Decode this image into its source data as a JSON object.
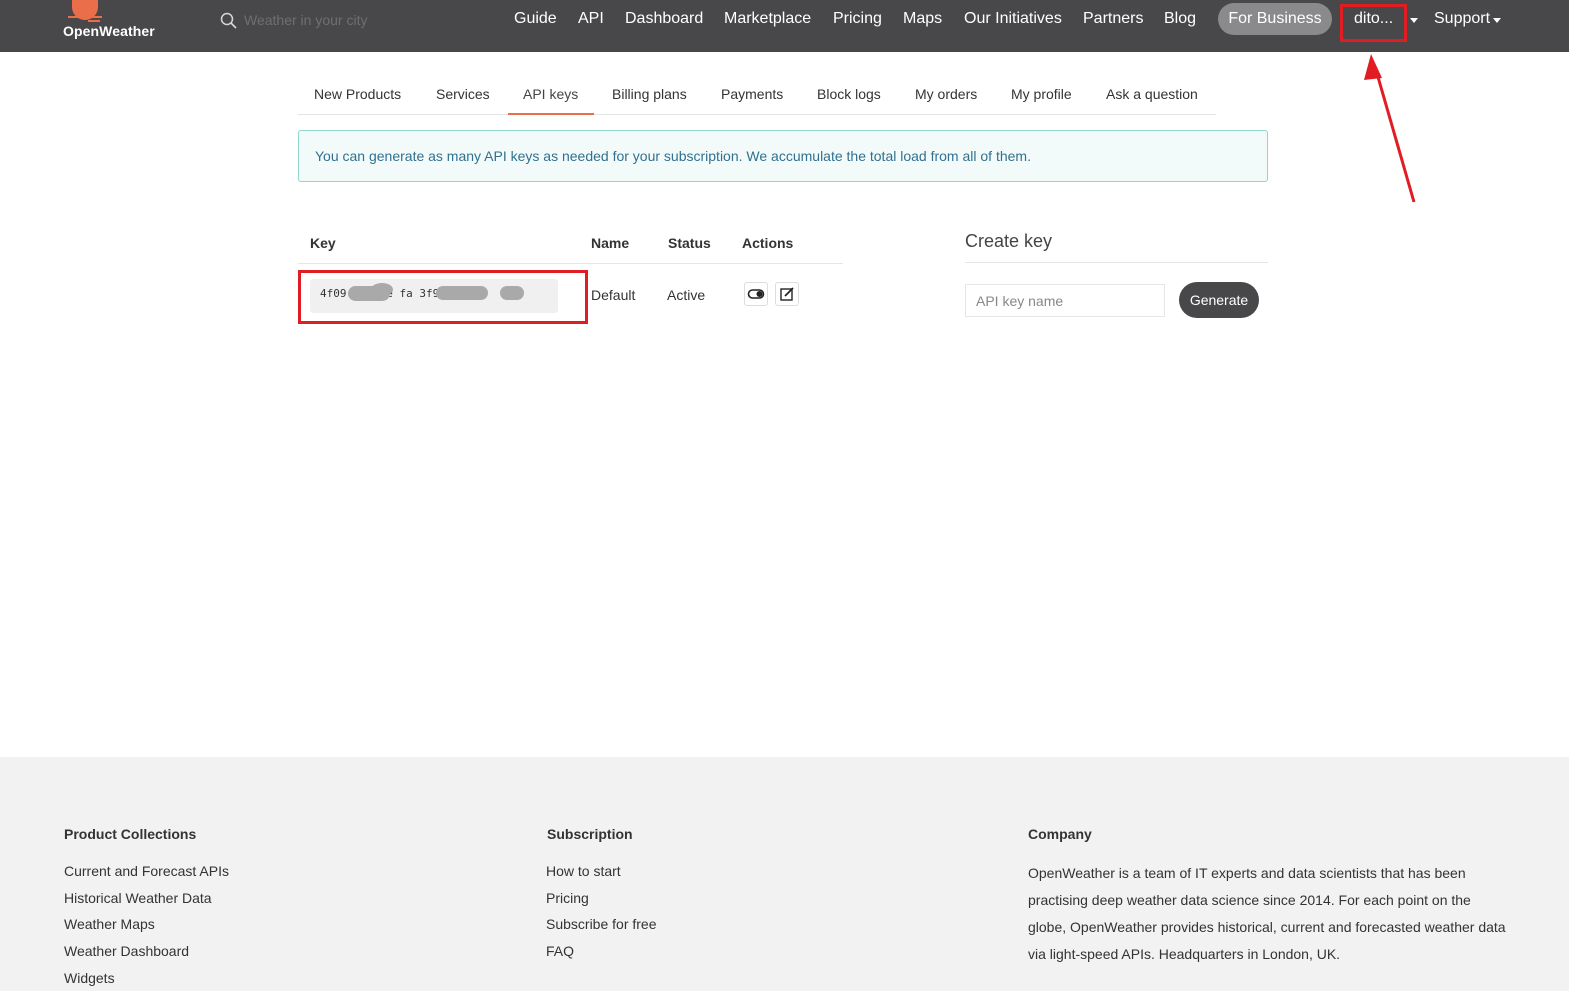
{
  "brand": {
    "name": "OpenWeather",
    "accent_color": "#eb6e4b",
    "header_color": "#48484a"
  },
  "search": {
    "placeholder": "Weather in your city",
    "icon": "search-icon"
  },
  "nav": {
    "items": [
      "Guide",
      "API",
      "Dashboard",
      "Marketplace",
      "Pricing",
      "Maps",
      "Our Initiatives",
      "Partners",
      "Blog"
    ],
    "business_label": "For Business",
    "user_label": "dito...",
    "support_label": "Support"
  },
  "tabs": {
    "items": [
      "New Products",
      "Services",
      "API keys",
      "Billing plans",
      "Payments",
      "Block logs",
      "My orders",
      "My profile",
      "Ask a question"
    ],
    "active": "API keys"
  },
  "alert": {
    "text": "You can generate as many API keys as needed for your subscription. We accumulate the total load from all of them."
  },
  "keys_table": {
    "headers": [
      "Key",
      "Name",
      "Status",
      "Actions"
    ],
    "rows": [
      {
        "key": "4f09  a0a  ee   fa  3f92",
        "name": "Default",
        "status": "Active",
        "actions": [
          "toggle-icon",
          "edit-icon"
        ]
      }
    ]
  },
  "create_key": {
    "title": "Create key",
    "input_placeholder": "API key name",
    "button_label": "Generate"
  },
  "footer": {
    "product_collections": {
      "title": "Product Collections",
      "links": [
        "Current and Forecast APIs",
        "Historical Weather Data",
        "Weather Maps",
        "Weather Dashboard",
        "Widgets"
      ]
    },
    "subscription": {
      "title": "Subscription",
      "links": [
        "How to start",
        "Pricing",
        "Subscribe for free",
        "FAQ"
      ]
    },
    "company": {
      "title": "Company",
      "text": "OpenWeather is a team of IT experts and data scientists that has been practising deep weather data science since 2014. For each point on the globe, OpenWeather provides historical, current and forecasted weather data via light-speed APIs. Headquarters in London, UK."
    }
  },
  "annotations": {
    "color": "#e11d24"
  }
}
